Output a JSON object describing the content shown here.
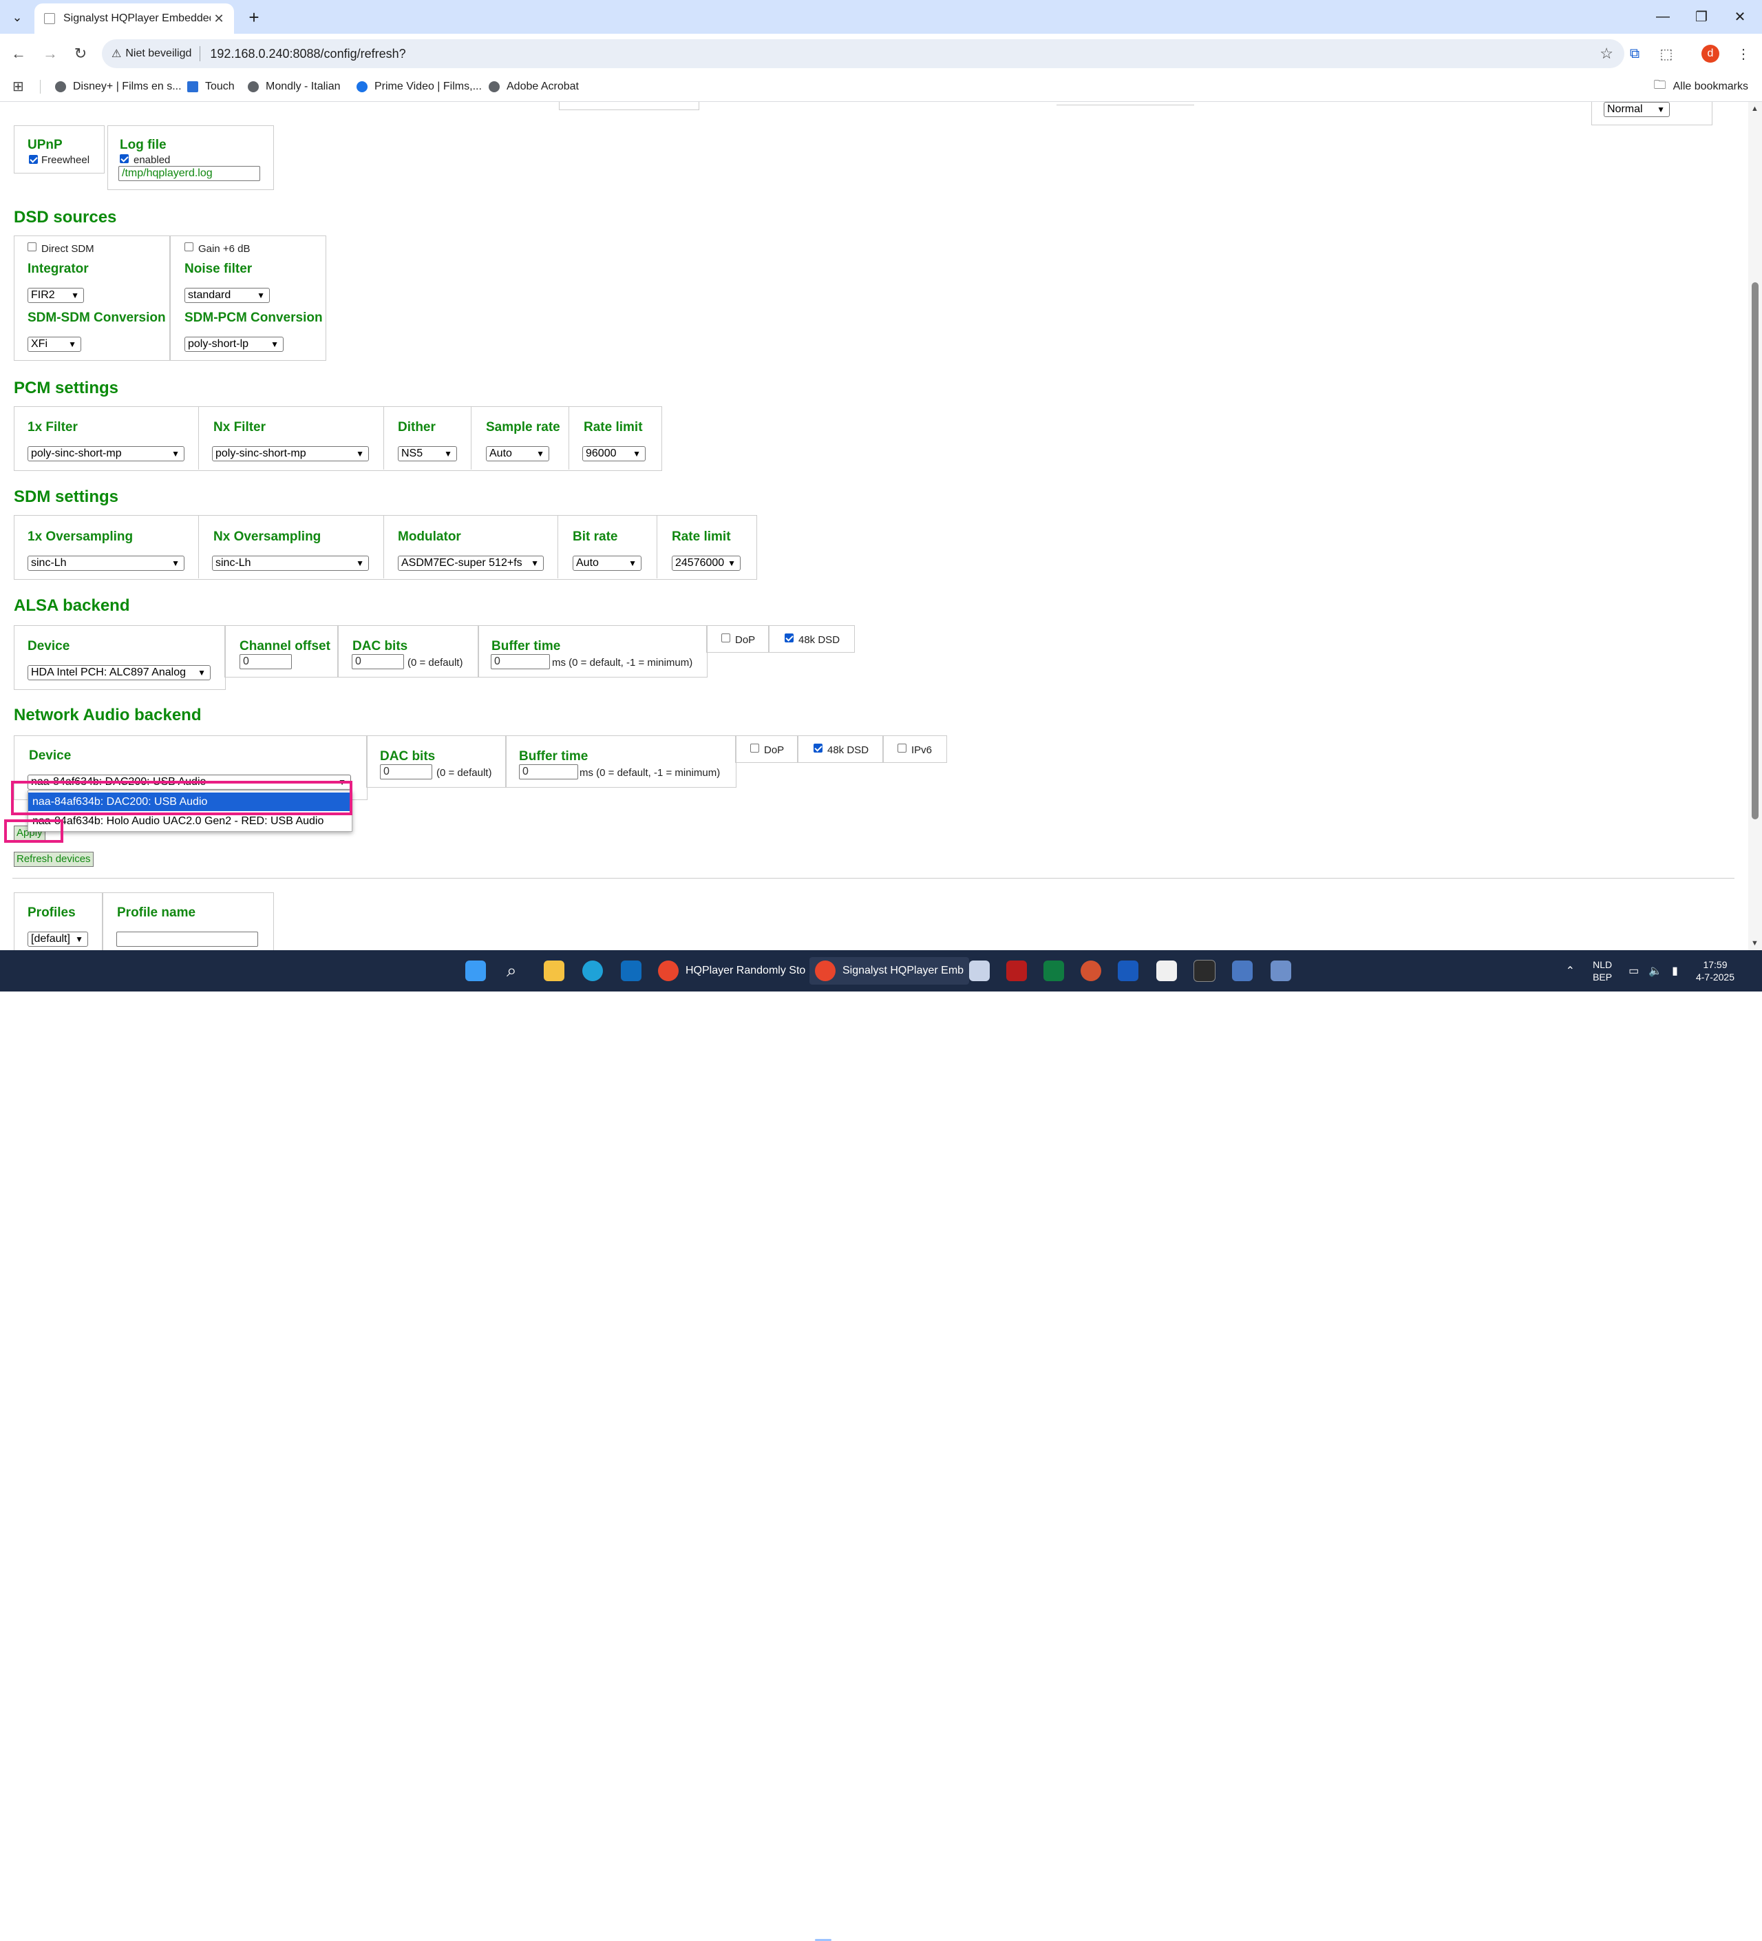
{
  "browser": {
    "tab_title": "Signalyst HQPlayer Embedded",
    "security_label": "Niet beveiligd",
    "url": "192.168.0.240:8088/config/refresh?",
    "profile_initial": "d",
    "bookmarks": [
      "Disney+ | Films en s...",
      "Touch",
      "Mondly - Italian",
      "Prime Video | Films,...",
      "Adobe Acrobat"
    ],
    "all_bookmarks": "Alle bookmarks"
  },
  "page": {
    "top_partial_select": "Normal",
    "upnp": {
      "title": "UPnP",
      "freewheel_label": "Freewheel",
      "freewheel_checked": true
    },
    "log_file": {
      "title": "Log file",
      "enabled_label": "enabled",
      "enabled_checked": true,
      "path": "/tmp/hqplayerd.log"
    },
    "dsd": {
      "title": "DSD sources",
      "direct_sdm_label": "Direct SDM",
      "gain_label": "Gain +6 dB",
      "integrator_label": "Integrator",
      "integrator_value": "FIR2",
      "noise_filter_label": "Noise filter",
      "noise_filter_value": "standard",
      "sdm_sdm_label": "SDM-SDM Conversion",
      "sdm_sdm_value": "XFi",
      "sdm_pcm_label": "SDM-PCM Conversion",
      "sdm_pcm_value": "poly-short-lp"
    },
    "pcm": {
      "title": "PCM settings",
      "filter1x_label": "1x Filter",
      "filter1x_value": "poly-sinc-short-mp",
      "filternx_label": "Nx Filter",
      "filternx_value": "poly-sinc-short-mp",
      "dither_label": "Dither",
      "dither_value": "NS5",
      "samplerate_label": "Sample rate",
      "samplerate_value": "Auto",
      "ratelimit_label": "Rate limit",
      "ratelimit_value": "96000"
    },
    "sdm": {
      "title": "SDM settings",
      "os1x_label": "1x Oversampling",
      "os1x_value": "sinc-Lh",
      "osnx_label": "Nx Oversampling",
      "osnx_value": "sinc-Lh",
      "modulator_label": "Modulator",
      "modulator_value": "ASDM7EC-super 512+fs",
      "bitrate_label": "Bit rate",
      "bitrate_value": "Auto",
      "ratelimit_label": "Rate limit",
      "ratelimit_value": "24576000"
    },
    "alsa": {
      "title": "ALSA backend",
      "device_label": "Device",
      "device_value": "HDA Intel PCH: ALC897 Analog",
      "channel_offset_label": "Channel offset",
      "channel_offset_value": "0",
      "dac_bits_label": "DAC bits",
      "dac_bits_value": "0",
      "dac_bits_note": "(0 = default)",
      "buffer_label": "Buffer time",
      "buffer_value": "0",
      "buffer_note": "ms (0 = default, -1 = minimum)",
      "dop_label": "DoP",
      "dop_checked": false,
      "dsd48k_label": "48k DSD",
      "dsd48k_checked": true
    },
    "network": {
      "title": "Network Audio backend",
      "device_label": "Device",
      "device_value": "naa-84af634b: DAC200: USB Audio",
      "dac_bits_label": "DAC bits",
      "dac_bits_value": "0",
      "dac_bits_note": "(0 = default)",
      "buffer_label": "Buffer time",
      "buffer_value": "0",
      "buffer_note": "ms (0 = default, -1 = minimum)",
      "dop_label": "DoP",
      "dop_checked": false,
      "dsd48k_label": "48k DSD",
      "dsd48k_checked": true,
      "ipv6_label": "IPv6",
      "ipv6_checked": false,
      "options": [
        "naa-84af634b: DAC200: USB Audio",
        "naa-84af634b: Holo Audio UAC2.0 Gen2 - RED: USB Audio"
      ]
    },
    "apply_label": "Apply",
    "refresh_label": "Refresh devices",
    "profiles": {
      "title": "Profiles",
      "value": "[default]",
      "name_label": "Profile name",
      "name_value": ""
    }
  },
  "taskbar": {
    "items": [
      "HQPlayer Randomly Sto",
      "Signalyst HQPlayer Emb"
    ],
    "lang": "NLD",
    "layout": "BEP",
    "time": "17:59",
    "date": "4-7-2025"
  },
  "colors": {
    "heading_green": "#118811",
    "select_blue": "#1a62d6",
    "highlight_pink": "#e91e84",
    "taskbar": "#1c2a44"
  }
}
